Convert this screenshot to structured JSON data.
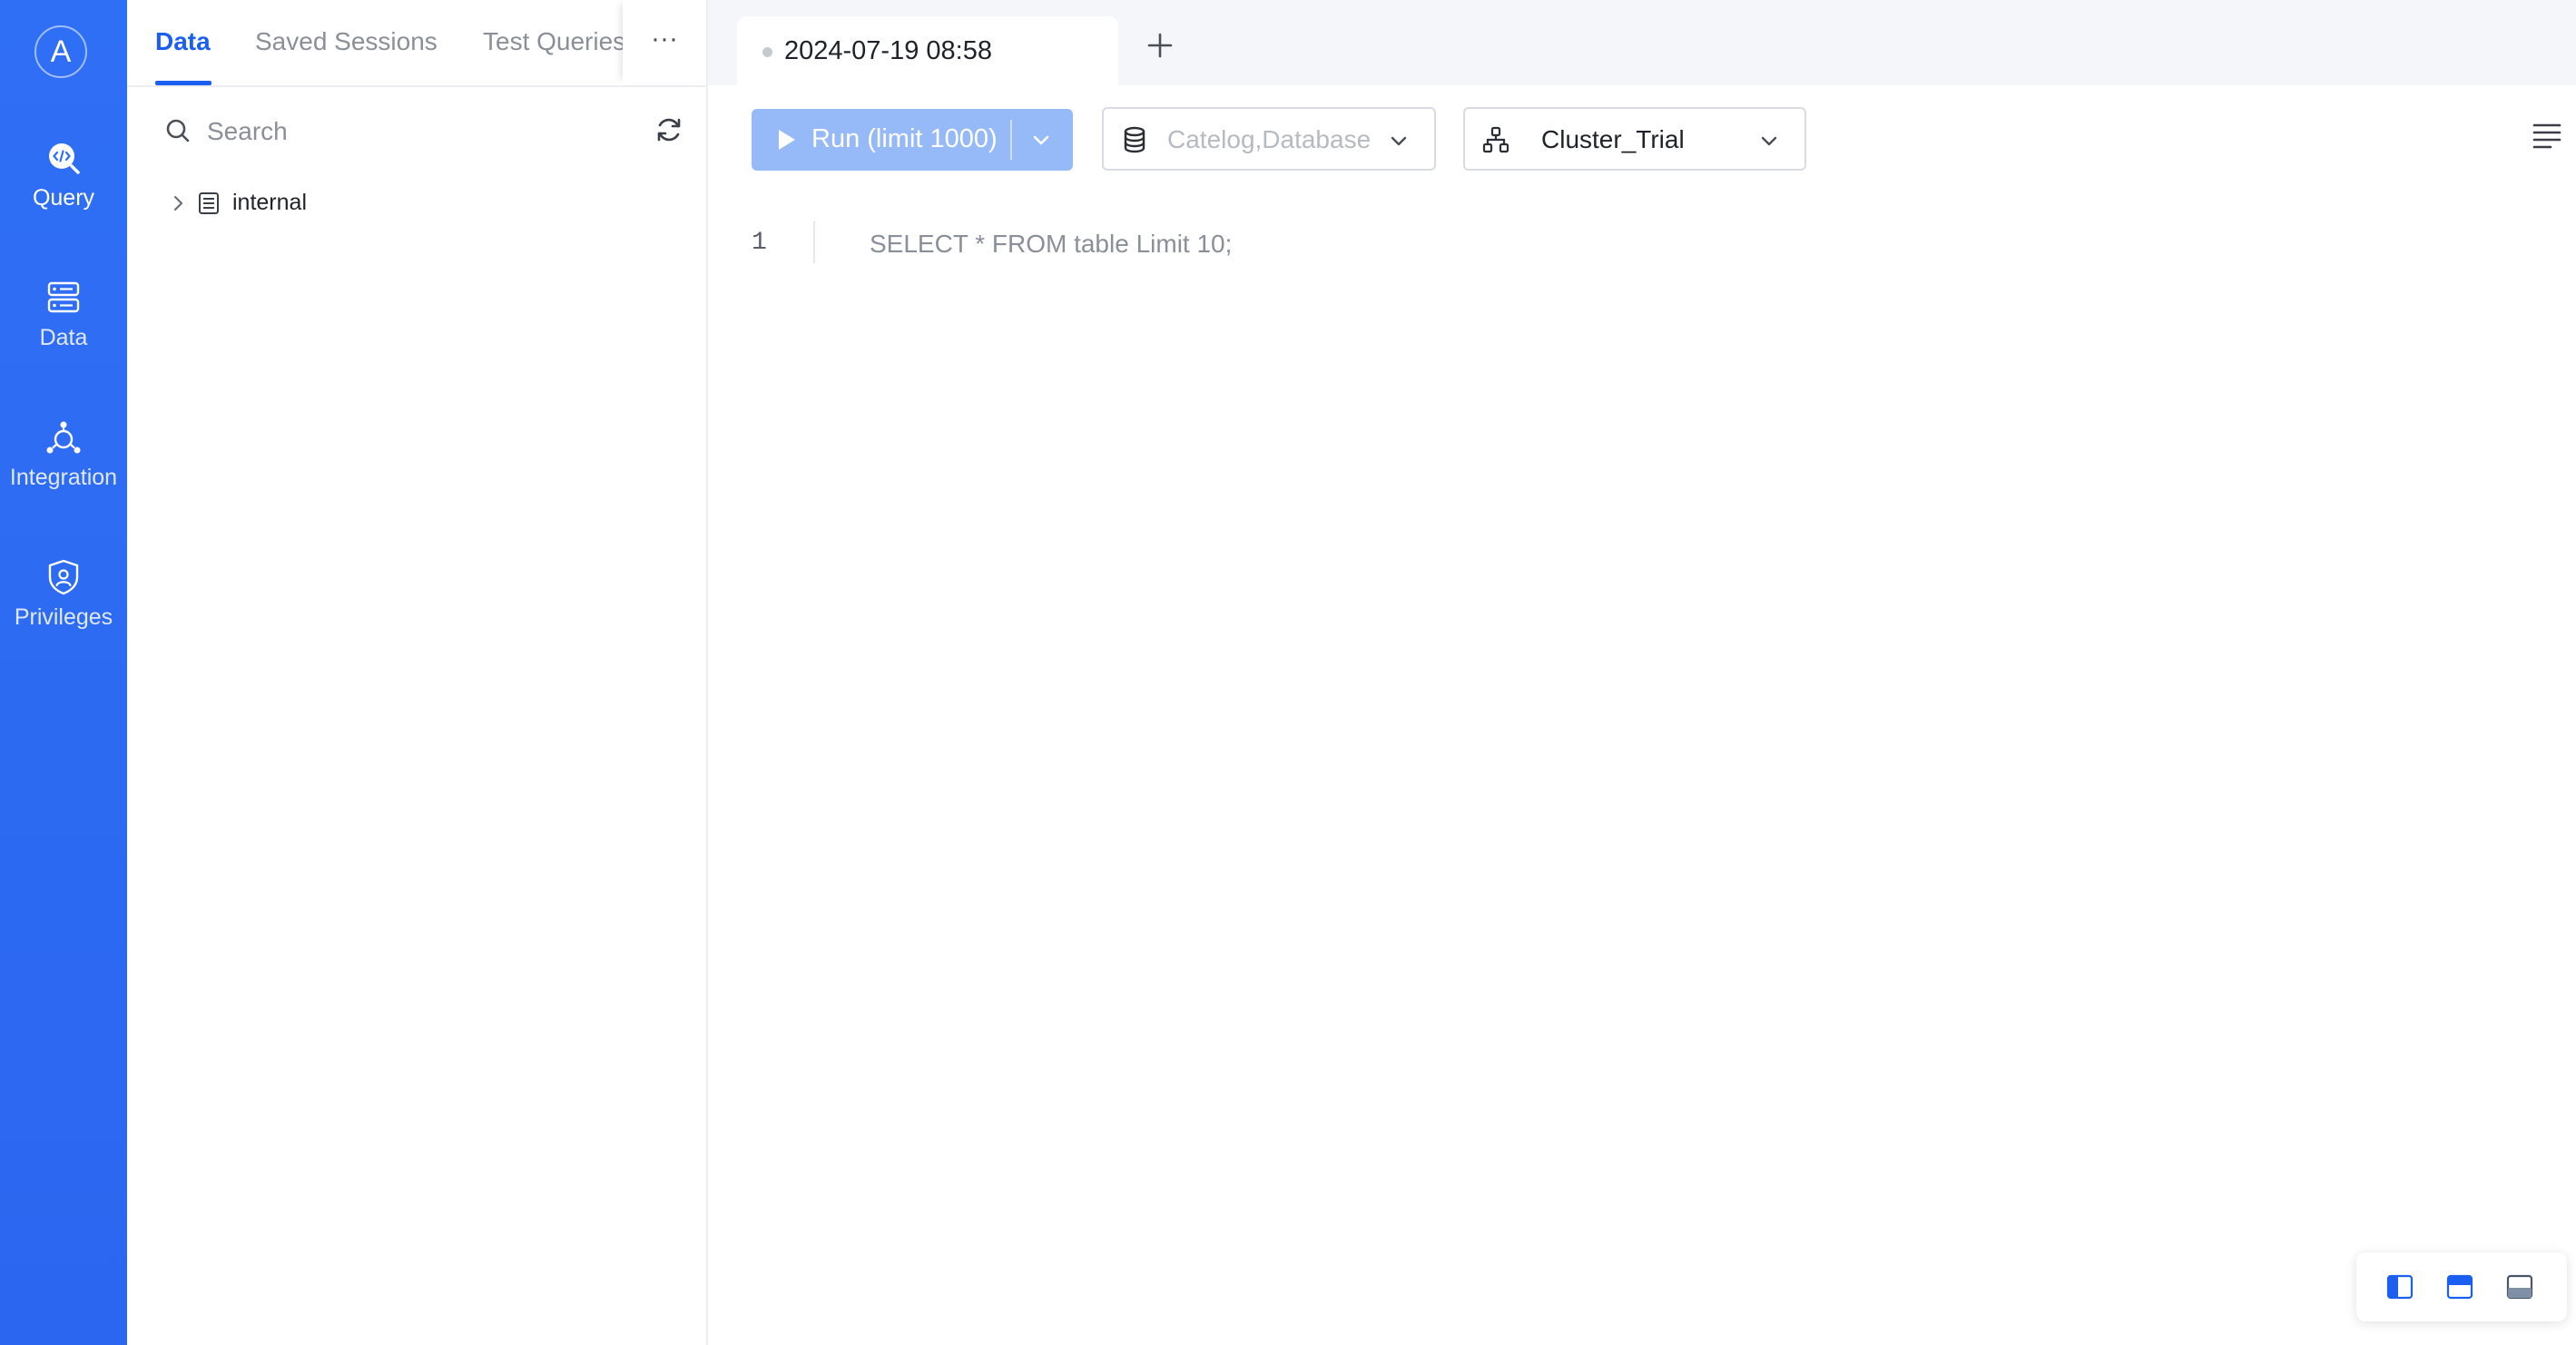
{
  "app": {
    "avatar_letter": "A",
    "accent_color": "#2f6ff5"
  },
  "nav": {
    "items": [
      {
        "label": "Query",
        "icon": "query-icon",
        "active": true
      },
      {
        "label": "Data",
        "icon": "server-icon",
        "active": false
      },
      {
        "label": "Integration",
        "icon": "integration-icon",
        "active": false
      },
      {
        "label": "Privileges",
        "icon": "shield-user-icon",
        "active": false
      }
    ]
  },
  "explorer": {
    "tabs": [
      {
        "label": "Data",
        "active": true
      },
      {
        "label": "Saved Sessions",
        "active": false
      },
      {
        "label": "Test Queries",
        "active": false
      }
    ],
    "more_label": "···",
    "search_placeholder": "Search",
    "tree": [
      {
        "name": "internal",
        "icon": "catalog-icon",
        "expanded": false
      }
    ]
  },
  "editor": {
    "session_tab": {
      "title": "2024-07-19 08:58"
    },
    "run_button": {
      "label": "Run (limit 1000)"
    },
    "database_select": {
      "placeholder": "Catelog,Database"
    },
    "cluster_select": {
      "value": "Cluster_Trial"
    },
    "lines": [
      {
        "number": "1",
        "text": "SELECT * FROM table Limit 10;"
      }
    ]
  },
  "layout_options": [
    "left-panel-layout",
    "top-panel-layout",
    "bottom-panel-layout"
  ]
}
